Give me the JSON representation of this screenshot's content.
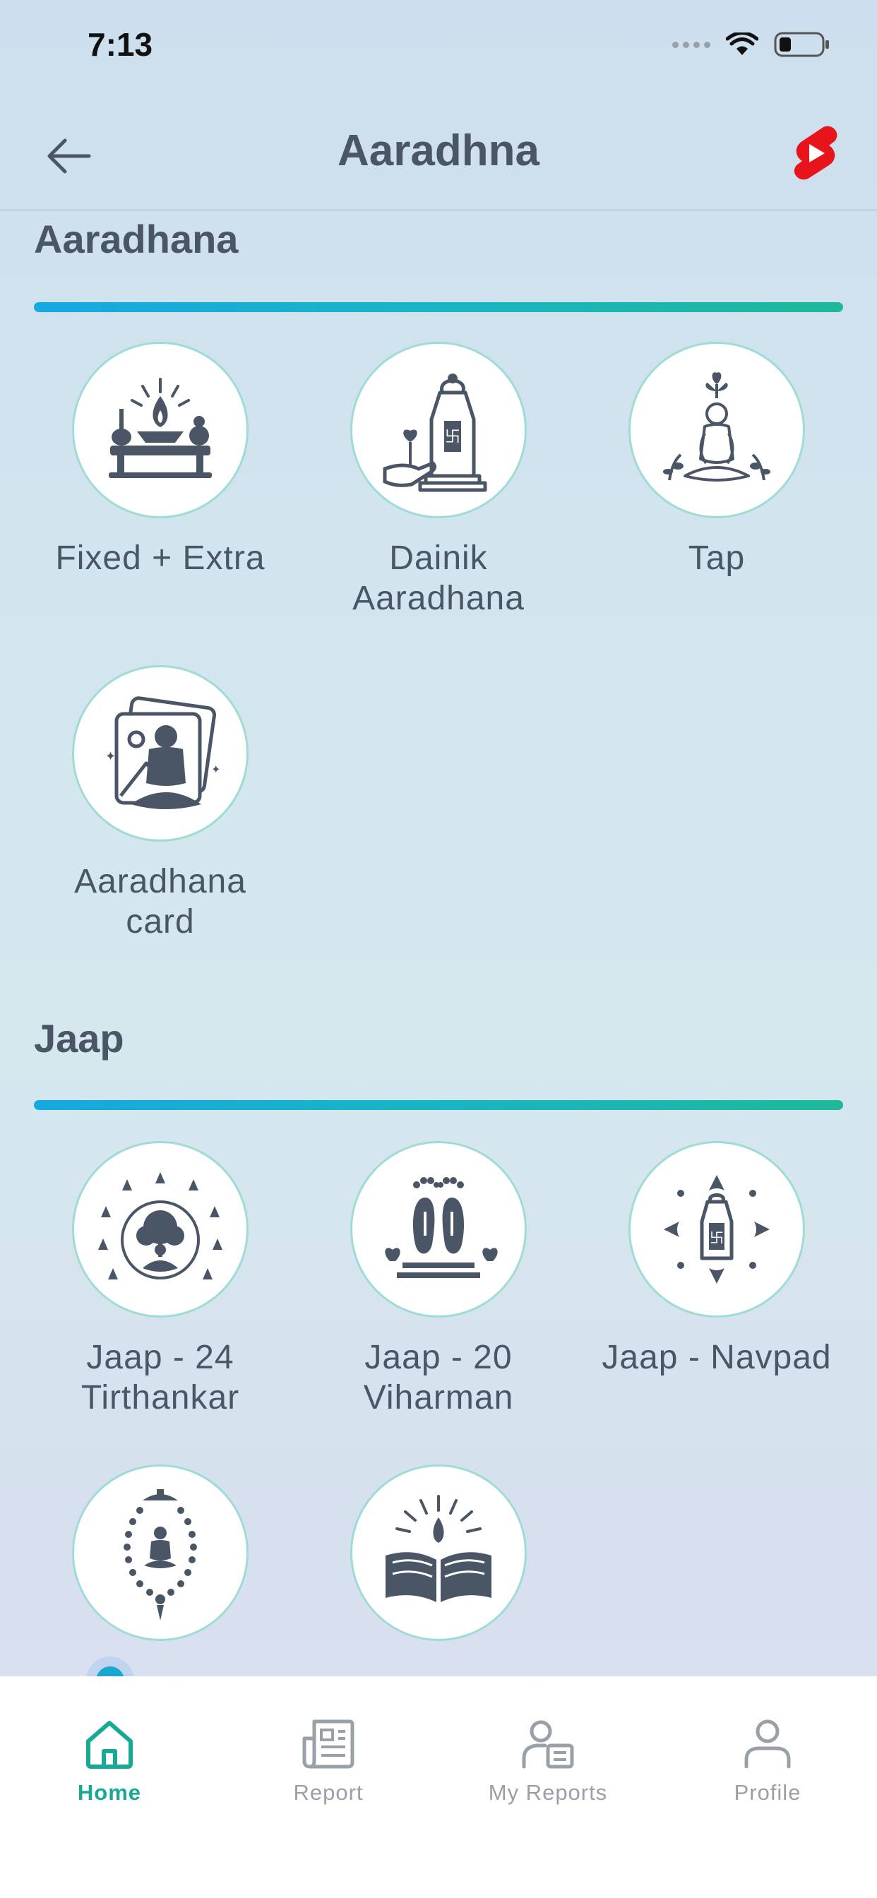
{
  "status_bar": {
    "time": "7:13"
  },
  "header": {
    "title": "Aaradhna",
    "back_icon": "arrow-left-icon",
    "shorts_icon": "youtube-shorts-icon"
  },
  "sections": [
    {
      "title": "Aaradhana",
      "items": [
        {
          "label": "Fixed + Extra",
          "icon": "altar-lamp-icon"
        },
        {
          "label": "Dainik\nAaradhana",
          "icon": "offering-hand-icon"
        },
        {
          "label": "Tap",
          "icon": "meditation-icon"
        },
        {
          "label": "Aaradhana\ncard",
          "icon": "photo-card-icon"
        }
      ]
    },
    {
      "title": "Jaap",
      "items": [
        {
          "label": "Jaap -  24\nTirthankar",
          "icon": "tirthankar-tree-icon"
        },
        {
          "label": "Jaap - 20\nViharman",
          "icon": "footprints-icon"
        },
        {
          "label": "Jaap - Navpad",
          "icon": "navpad-icon"
        },
        {
          "label": "",
          "icon": "mala-icon"
        },
        {
          "label": "",
          "icon": "scripture-book-icon"
        }
      ]
    }
  ],
  "bottom_nav": [
    {
      "label": "Home",
      "icon": "home-icon",
      "active": true
    },
    {
      "label": "Report",
      "icon": "report-icon",
      "active": false
    },
    {
      "label": "My Reports",
      "icon": "my-reports-icon",
      "active": false
    },
    {
      "label": "Profile",
      "icon": "profile-icon",
      "active": false
    }
  ],
  "colors": {
    "accent": "#17a992",
    "text": "#4a5565",
    "divider_start": "#16a8e2",
    "divider_end": "#1fb89a",
    "shorts": "#e8141c"
  }
}
